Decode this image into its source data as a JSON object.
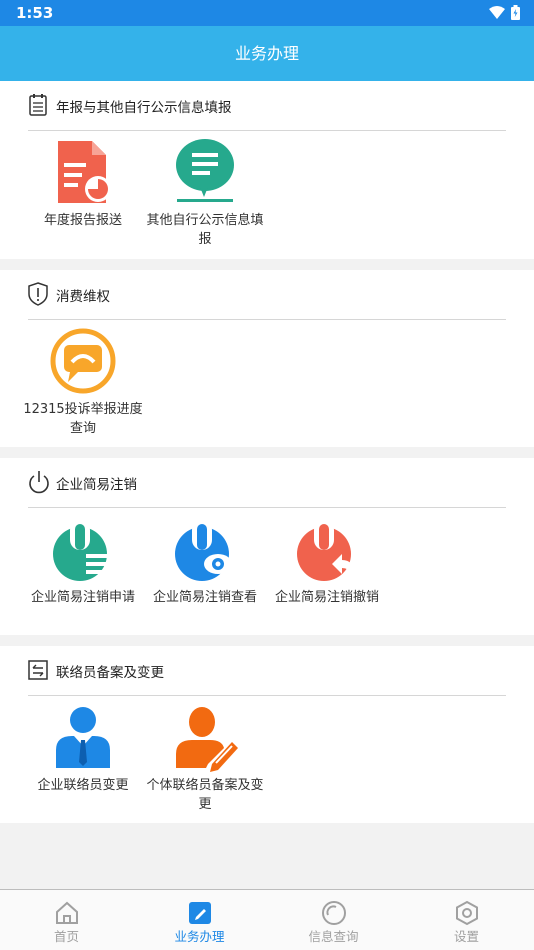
{
  "status_bar": {
    "time": "1:53",
    "icons": [
      "wifi-icon",
      "battery-icon"
    ]
  },
  "app_bar": {
    "title": "业务办理"
  },
  "sections": [
    {
      "title": "年报与其他自行公示信息填报",
      "icon": "clipboard-icon",
      "items": [
        {
          "label": "年度报告报送",
          "icon": "annual-report-icon"
        },
        {
          "label": "其他自行公示信息填报",
          "icon": "chat-document-icon"
        }
      ]
    },
    {
      "title": "消费维权",
      "icon": "shield-icon",
      "items": [
        {
          "label": "12315投诉举报进度查询",
          "icon": "complaint-chat-icon"
        }
      ]
    },
    {
      "title": "企业简易注销",
      "icon": "power-icon",
      "items": [
        {
          "label": "企业简易注销申请",
          "icon": "power-list-icon"
        },
        {
          "label": "企业简易注销查看",
          "icon": "power-eye-icon"
        },
        {
          "label": "企业简易注销撤销",
          "icon": "power-undo-icon"
        }
      ]
    },
    {
      "title": "联络员备案及变更",
      "icon": "swap-icon",
      "items": [
        {
          "label": "企业联络员变更",
          "icon": "person-tie-icon"
        },
        {
          "label": "个体联络员备案及变更",
          "icon": "person-edit-icon"
        }
      ]
    }
  ],
  "tab_bar": {
    "active": "业务办理",
    "tabs": [
      {
        "label": "首页",
        "icon": "home-icon"
      },
      {
        "label": "业务办理",
        "icon": "edit-icon"
      },
      {
        "label": "信息查询",
        "icon": "search-circle-icon"
      },
      {
        "label": "设置",
        "icon": "settings-icon"
      }
    ]
  },
  "colors": {
    "status_bar": "#1e88e5",
    "app_bar": "#34b2ea",
    "tab_active": "#1e88e5",
    "tab_inactive": "#a0a0a0",
    "red_icon": "#f0624d",
    "green_icon": "#26a98d",
    "orange_icon": "#f8a62a",
    "blue_icon": "#1e88e5",
    "contact_orange": "#f26a11"
  }
}
